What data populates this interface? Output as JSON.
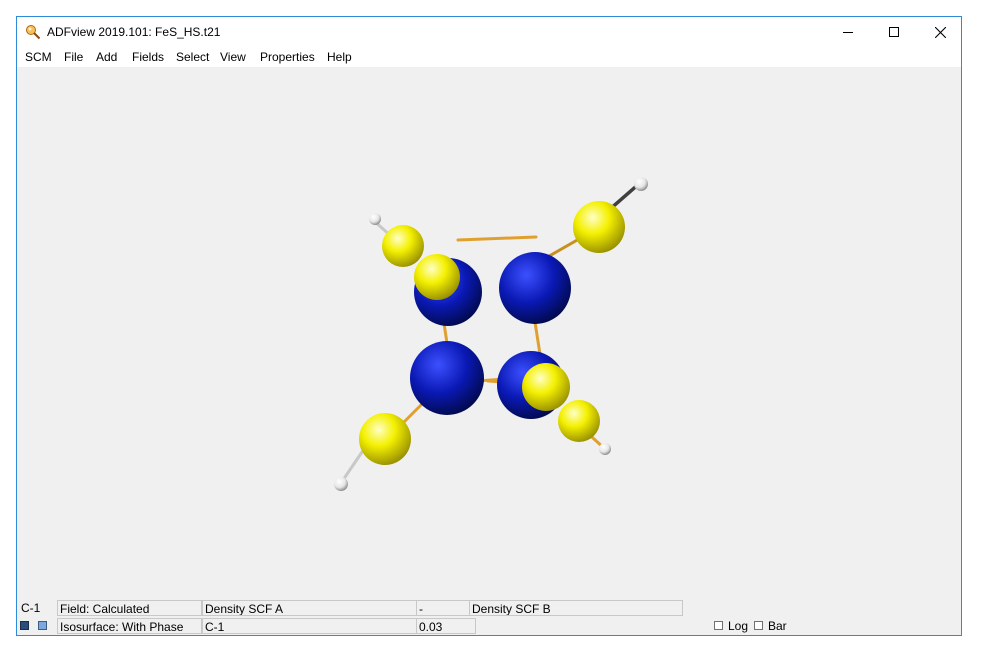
{
  "window": {
    "title": "ADFview 2019.101: FeS_HS.t21"
  },
  "menu": {
    "items": [
      "SCM",
      "File",
      "Add",
      "Fields",
      "Select",
      "View",
      "Properties",
      "Help"
    ]
  },
  "status": {
    "row1": {
      "atom": "C-1",
      "field": "Field: Calculated",
      "density_a": "Density SCF A",
      "dash": "-",
      "density_b": "Density SCF B"
    },
    "row2": {
      "isosurface": "Isosurface: With Phase",
      "atom": "C-1",
      "value": "0.03",
      "log_label": "Log",
      "bar_label": "Bar"
    }
  },
  "colors": {
    "iron": "#0a19b4",
    "sulfur": "#f0f000",
    "hydrogen": "#ffffff",
    "bond": "#e0a030",
    "window_border": "#2e8bd8",
    "viewport_bg": "#f0f0f0"
  }
}
